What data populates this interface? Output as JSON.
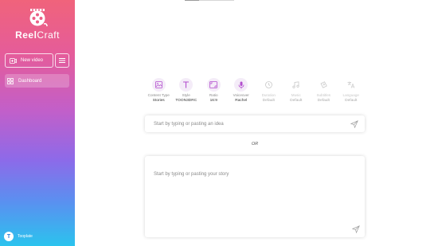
{
  "sidebar": {
    "brand": {
      "part1": "Reel",
      "part2": "Craft"
    },
    "new_video_label": "New video",
    "dashboard_label": "Dashboard",
    "user": {
      "initial": "T",
      "name": "Tooplate"
    }
  },
  "options": [
    {
      "key": "content_type",
      "label": "Content Type",
      "value": "Stories",
      "icon": "image-icon",
      "active": true
    },
    {
      "key": "style",
      "label": "Style",
      "value": "TOON3DRC",
      "icon": "text-style-icon",
      "active": true
    },
    {
      "key": "ratio",
      "label": "Ratio",
      "value": "16:9",
      "icon": "aspect-ratio-icon",
      "active": true
    },
    {
      "key": "voiceover",
      "label": "Voiceover",
      "value": "Rachel",
      "icon": "microphone-icon",
      "active": true
    },
    {
      "key": "duration",
      "label": "Duration",
      "value": "Default",
      "icon": "clock-icon",
      "active": false
    },
    {
      "key": "music",
      "label": "Music",
      "value": "Default",
      "icon": "music-note-icon",
      "active": false
    },
    {
      "key": "subtitles",
      "label": "Subtitles",
      "value": "Default",
      "icon": "subtitles-icon",
      "active": false
    },
    {
      "key": "language",
      "label": "Language",
      "value": "Default",
      "icon": "translate-icon",
      "active": false
    }
  ],
  "idea_input": {
    "placeholder": "Start by typing or pasting an idea"
  },
  "or_separator": "OR",
  "story_input": {
    "placeholder": "Start by typing or pasting your story"
  },
  "colors": {
    "accent": "#b34fce",
    "gradient_top": "#f0637b",
    "gradient_bottom": "#2bc3ee"
  }
}
